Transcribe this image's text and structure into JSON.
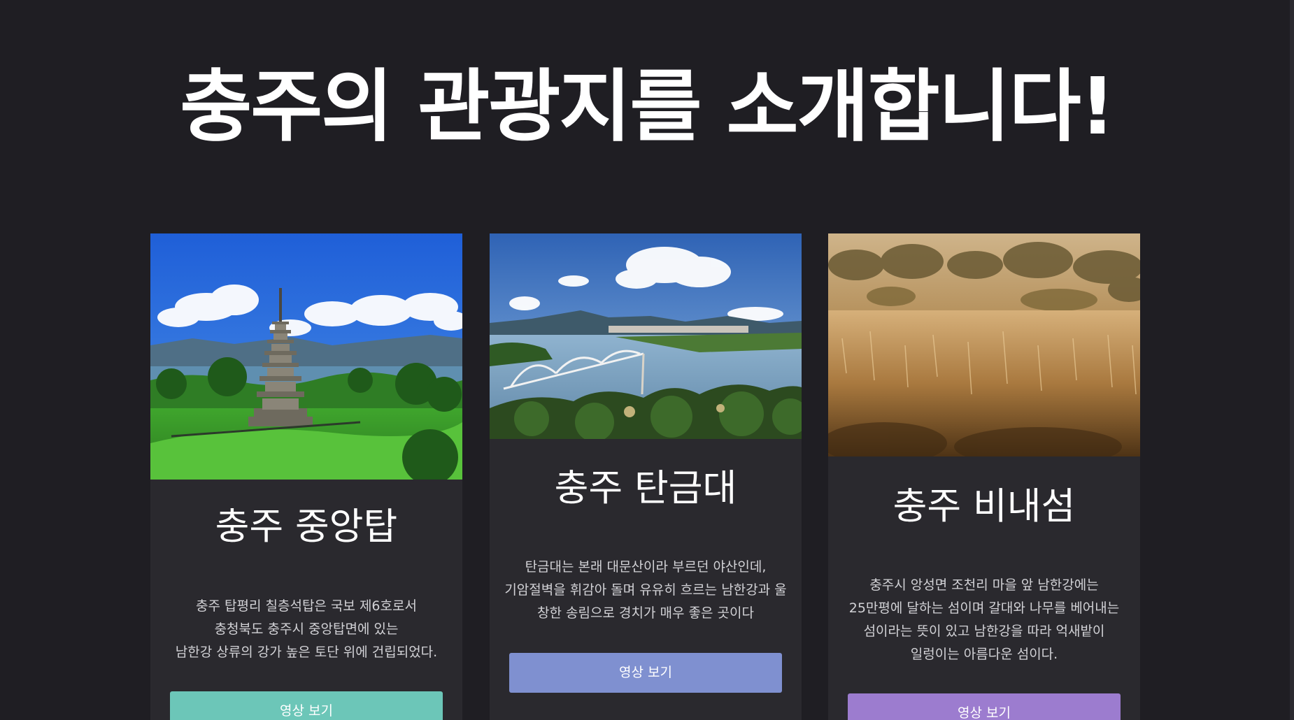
{
  "page": {
    "title": "충주의 관광지를 소개합니다!",
    "background": "#1f1e23"
  },
  "cards": [
    {
      "title": "충주 중앙탑",
      "image": "pagoda-photo",
      "description": [
        "충주 탑평리 칠층석탑은 국보 제6호로서",
        "충청북도 충주시 중앙탑면에 있는",
        "남한강 상류의 강가 높은 토단 위에 건립되었다."
      ],
      "button_label": "영상 보기",
      "button_color": "#6cc6b8"
    },
    {
      "title": "충주 탄금대",
      "image": "river-bridge-photo",
      "description": [
        "탄금대는 본래 대문산이라 부르던 야산인데,",
        "기암절벽을 휘감아 돌며 유유히 흐르는 남한강과 울",
        "창한 송림으로 경치가 매우 좋은 곳이다"
      ],
      "button_label": "영상 보기",
      "button_color": "#7f90d0"
    },
    {
      "title": "충주 비내섬",
      "image": "reed-field-photo",
      "description": [
        "충주시 앙성면 조천리 마을 앞 남한강에는",
        "25만평에 달하는 섬이며 갈대와 나무를 베어내는",
        "섬이라는 뜻이 있고 남한강을 따라 억새밭이",
        "일렁이는 아름다운 섬이다."
      ],
      "button_label": "영상 보기",
      "button_color": "#9c7ccf"
    }
  ]
}
